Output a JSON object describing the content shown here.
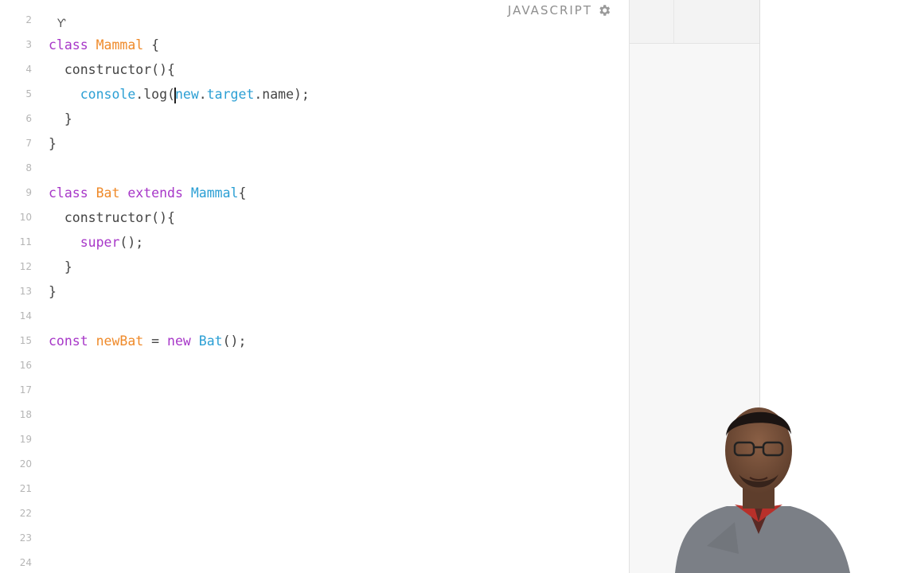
{
  "header": {
    "language_label": "JAVASCRIPT",
    "settings_icon": "gear-icon"
  },
  "code_lines": [
    {
      "number": "2",
      "tokens": []
    },
    {
      "number": "3",
      "tokens": [
        {
          "t": "class",
          "k": "keyword"
        },
        {
          "t": " ",
          "k": "plain"
        },
        {
          "t": "Mammal",
          "k": "class"
        },
        {
          "t": " {",
          "k": "plain"
        }
      ]
    },
    {
      "number": "4",
      "tokens": [
        {
          "t": "  constructor(){",
          "k": "plain"
        }
      ]
    },
    {
      "number": "5",
      "tokens": [
        {
          "t": "    ",
          "k": "plain"
        },
        {
          "t": "console",
          "k": "fn"
        },
        {
          "t": ".log(",
          "k": "plain"
        },
        {
          "t": "|",
          "k": "caret"
        },
        {
          "t": "new",
          "k": "fn"
        },
        {
          "t": ".",
          "k": "plain"
        },
        {
          "t": "target",
          "k": "fn"
        },
        {
          "t": ".name);",
          "k": "plain"
        }
      ]
    },
    {
      "number": "6",
      "tokens": [
        {
          "t": "  }",
          "k": "plain"
        }
      ]
    },
    {
      "number": "7",
      "tokens": [
        {
          "t": "}",
          "k": "plain"
        }
      ]
    },
    {
      "number": "8",
      "tokens": []
    },
    {
      "number": "9",
      "tokens": [
        {
          "t": "class",
          "k": "keyword"
        },
        {
          "t": " ",
          "k": "plain"
        },
        {
          "t": "Bat",
          "k": "class"
        },
        {
          "t": " ",
          "k": "plain"
        },
        {
          "t": "extends",
          "k": "keyword"
        },
        {
          "t": " ",
          "k": "plain"
        },
        {
          "t": "Mammal",
          "k": "fn"
        },
        {
          "t": "{",
          "k": "plain"
        }
      ]
    },
    {
      "number": "10",
      "tokens": [
        {
          "t": "  constructor(){",
          "k": "plain"
        }
      ]
    },
    {
      "number": "11",
      "tokens": [
        {
          "t": "    ",
          "k": "plain"
        },
        {
          "t": "super",
          "k": "keyword"
        },
        {
          "t": "();",
          "k": "plain"
        }
      ]
    },
    {
      "number": "12",
      "tokens": [
        {
          "t": "  }",
          "k": "plain"
        }
      ]
    },
    {
      "number": "13",
      "tokens": [
        {
          "t": "}",
          "k": "plain"
        }
      ]
    },
    {
      "number": "14",
      "tokens": []
    },
    {
      "number": "15",
      "tokens": [
        {
          "t": "const",
          "k": "keyword"
        },
        {
          "t": " ",
          "k": "plain"
        },
        {
          "t": "newBat",
          "k": "class"
        },
        {
          "t": " = ",
          "k": "plain"
        },
        {
          "t": "new",
          "k": "keyword"
        },
        {
          "t": " ",
          "k": "plain"
        },
        {
          "t": "Bat",
          "k": "fn"
        },
        {
          "t": "();",
          "k": "plain"
        }
      ]
    },
    {
      "number": "16",
      "tokens": []
    },
    {
      "number": "17",
      "tokens": []
    },
    {
      "number": "18",
      "tokens": []
    },
    {
      "number": "19",
      "tokens": []
    },
    {
      "number": "20",
      "tokens": []
    },
    {
      "number": "21",
      "tokens": []
    },
    {
      "number": "22",
      "tokens": []
    },
    {
      "number": "23",
      "tokens": []
    },
    {
      "number": "24",
      "tokens": []
    }
  ],
  "colors": {
    "keyword": "#a737c8",
    "class_name": "#ef8a2a",
    "identifier": "#2b9fd4",
    "plain": "#444444"
  },
  "webcam": {
    "icon": "presenter-video"
  }
}
